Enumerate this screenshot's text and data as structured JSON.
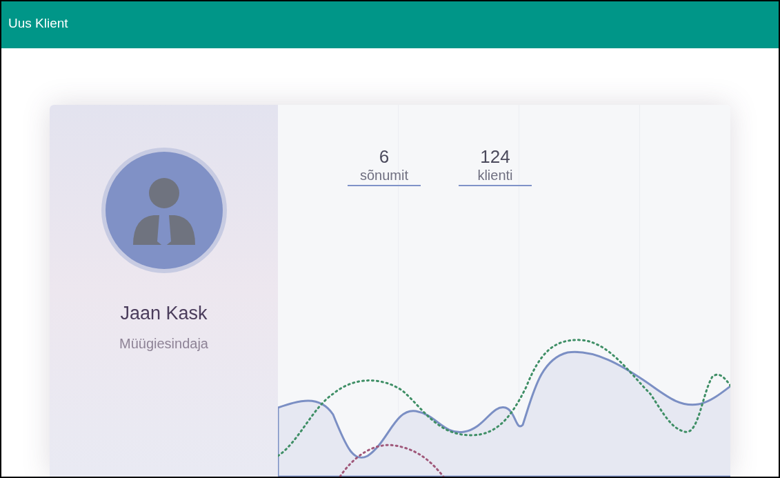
{
  "app_bar": {
    "title": "Uus Klient"
  },
  "profile": {
    "name": "Jaan Kask",
    "role": "Müügiesindaja"
  },
  "stats": [
    {
      "value": "6",
      "label": "sõnumit"
    },
    {
      "value": "124",
      "label": "klienti"
    }
  ]
}
